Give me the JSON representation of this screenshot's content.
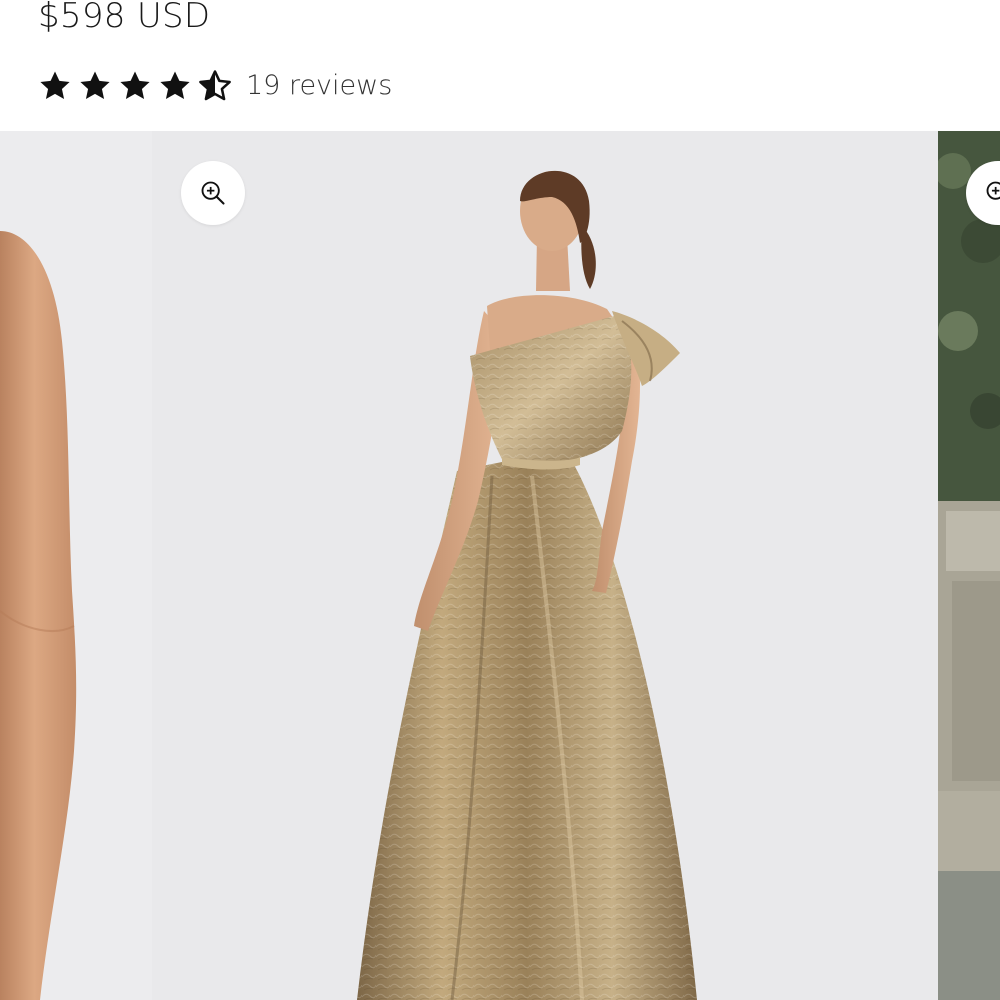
{
  "product": {
    "price": "$598 USD",
    "rating": 4.5,
    "rating_max": 5,
    "reviews_label": "19 reviews"
  },
  "gallery": {
    "slides": [
      {
        "name": "arm-closeup-photo",
        "background": "#ececee"
      },
      {
        "name": "gold-gown-back-view-photo",
        "background": "#e9e9eb"
      },
      {
        "name": "garden-stone-photo",
        "background": "#5b6356"
      }
    ],
    "zoom_icon": "zoom-in-icon"
  },
  "colors": {
    "star": "#111111",
    "gown_gold": "#a88f63",
    "skin": "#d8a27e"
  }
}
